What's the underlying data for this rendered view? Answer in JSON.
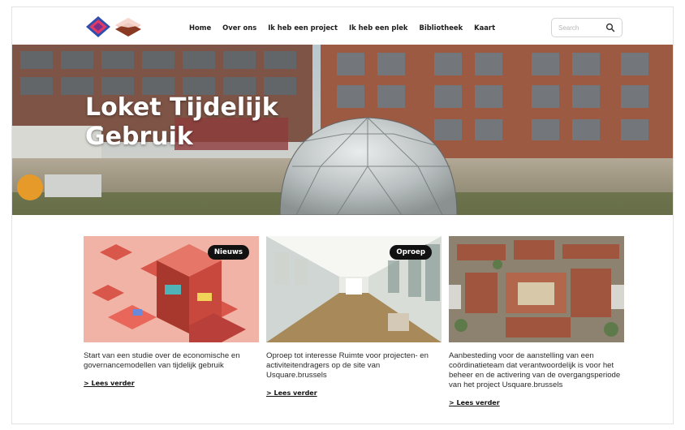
{
  "header": {
    "nav": [
      "Home",
      "Over ons",
      "Ik heb een project",
      "Ik heb een plek",
      "Bibliotheek",
      "Kaart"
    ],
    "search_placeholder": "Search"
  },
  "hero": {
    "title_line1": "Loket Tijdelijk",
    "title_line2": "Gebruik"
  },
  "cards": [
    {
      "badge": "Nieuws",
      "text": "Start van een studie over de economische en governancemodellen van tijdelijk gebruik",
      "more": "> Lees verder"
    },
    {
      "badge": "Oproep",
      "text": "Oproep tot interesse Ruimte voor projecten- en activiteitendragers op de site van Usquare.brussels",
      "more": "> Lees verder"
    },
    {
      "badge": "",
      "text": "Aanbesteding voor de aanstelling van een coördinatieteam dat verantwoordelijk is voor het beheer en de activering van de overgangsperiode van het project Usquare.brussels",
      "more": "> Lees verder"
    }
  ],
  "colors": {
    "logo_blue": "#2f4fb0",
    "logo_pink": "#e03a66",
    "logo_brown": "#8a3a22",
    "brick": "#9c5a43",
    "card1_bg": "#f0b3a6"
  }
}
